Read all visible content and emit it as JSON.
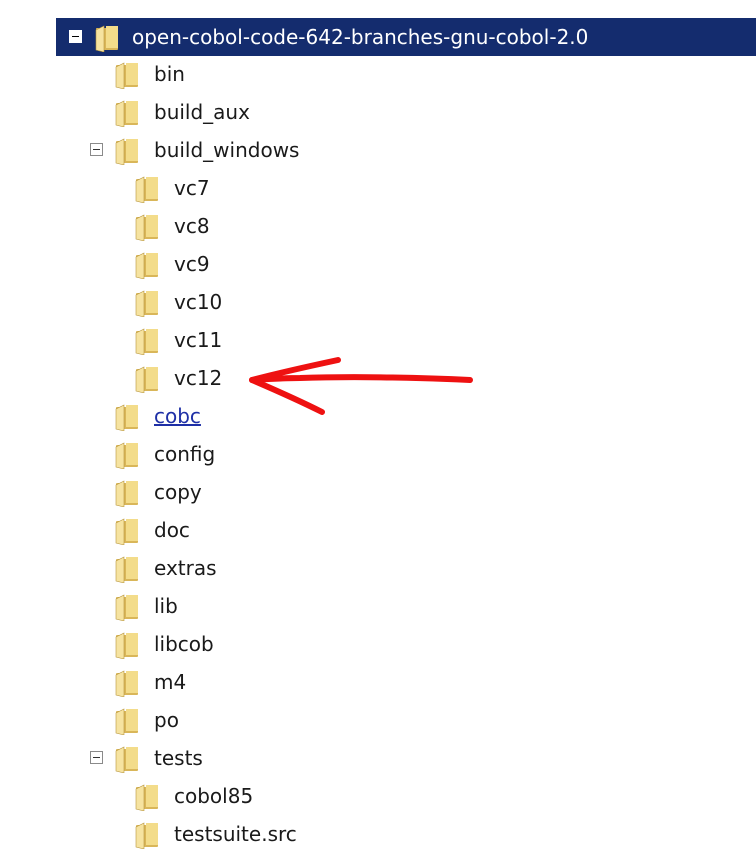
{
  "tree": {
    "root": {
      "label": "open-cobol-code-642-branches-gnu-cobol-2.0",
      "expanded": true,
      "selected": true
    },
    "items": [
      {
        "label": "bin",
        "level": 1
      },
      {
        "label": "build_aux",
        "level": 1
      },
      {
        "label": "build_windows",
        "level": 1,
        "expanded": true
      },
      {
        "label": "vc7",
        "level": 2
      },
      {
        "label": "vc8",
        "level": 2
      },
      {
        "label": "vc9",
        "level": 2
      },
      {
        "label": "vc10",
        "level": 2
      },
      {
        "label": "vc11",
        "level": 2
      },
      {
        "label": "vc12",
        "level": 2
      },
      {
        "label": "cobc",
        "level": 1,
        "link": true
      },
      {
        "label": "config",
        "level": 1
      },
      {
        "label": "copy",
        "level": 1
      },
      {
        "label": "doc",
        "level": 1
      },
      {
        "label": "extras",
        "level": 1
      },
      {
        "label": "lib",
        "level": 1
      },
      {
        "label": "libcob",
        "level": 1
      },
      {
        "label": "m4",
        "level": 1
      },
      {
        "label": "po",
        "level": 1
      },
      {
        "label": "tests",
        "level": 1,
        "expanded": true
      },
      {
        "label": "cobol85",
        "level": 2
      },
      {
        "label": "testsuite.src",
        "level": 2
      }
    ]
  },
  "colors": {
    "selection": "#142c6e",
    "link": "#1e2fa6",
    "annotation_arrow": "#ee1111",
    "folder_light": "#f6e3a0",
    "folder_dark": "#d9b659"
  },
  "icons": {
    "folder": "folder-icon",
    "expander": "collapse-minus-icon"
  },
  "annotation": {
    "shape": "hand-drawn-arrow",
    "points_to": "vc12"
  }
}
